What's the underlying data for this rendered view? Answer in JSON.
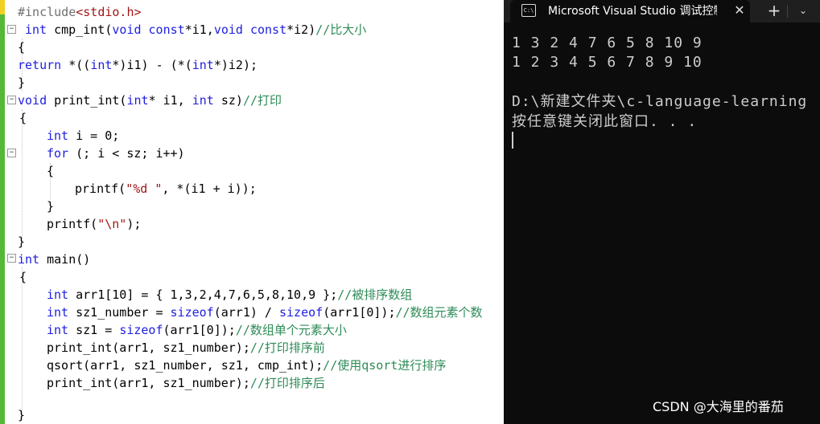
{
  "editor": {
    "lines": [
      {
        "segments": [
          {
            "c": "pp",
            "t": "#include"
          },
          {
            "c": "st",
            "t": "<stdio.h>"
          }
        ]
      },
      {
        "segments": [
          {
            "c": "kw",
            "t": "int"
          },
          {
            "c": "",
            "t": " cmp_int("
          },
          {
            "c": "kw",
            "t": "void const"
          },
          {
            "c": "",
            "t": "*i1,"
          },
          {
            "c": "kw",
            "t": "void const"
          },
          {
            "c": "",
            "t": "*i2)"
          },
          {
            "c": "cm",
            "t": "//比大小"
          }
        ]
      },
      {
        "segments": [
          {
            "c": "",
            "t": "{"
          }
        ]
      },
      {
        "segments": [
          {
            "c": "kw",
            "t": "return"
          },
          {
            "c": "",
            "t": " *(("
          },
          {
            "c": "kw",
            "t": "int"
          },
          {
            "c": "",
            "t": "*)i1) - (*("
          },
          {
            "c": "kw",
            "t": "int"
          },
          {
            "c": "",
            "t": "*)i2);"
          }
        ]
      },
      {
        "segments": [
          {
            "c": "",
            "t": "}"
          }
        ]
      },
      {
        "segments": [
          {
            "c": "kw",
            "t": "void"
          },
          {
            "c": "",
            "t": " print_int("
          },
          {
            "c": "kw",
            "t": "int"
          },
          {
            "c": "",
            "t": "* i1, "
          },
          {
            "c": "kw",
            "t": "int"
          },
          {
            "c": "",
            "t": " sz)"
          },
          {
            "c": "cm",
            "t": "//打印"
          }
        ]
      },
      {
        "segments": [
          {
            "c": "",
            "t": "{"
          }
        ]
      },
      {
        "segments": [
          {
            "c": "kw",
            "t": "int"
          },
          {
            "c": "",
            "t": " i = 0;"
          }
        ]
      },
      {
        "segments": [
          {
            "c": "kw",
            "t": "for"
          },
          {
            "c": "",
            "t": " (; i < sz; i++)"
          }
        ]
      },
      {
        "segments": [
          {
            "c": "",
            "t": "{"
          }
        ]
      },
      {
        "segments": [
          {
            "c": "",
            "t": "printf("
          },
          {
            "c": "st",
            "t": "\"%d \""
          },
          {
            "c": "",
            "t": ", *(i1 + i));"
          }
        ]
      },
      {
        "segments": [
          {
            "c": "",
            "t": "}"
          }
        ]
      },
      {
        "segments": [
          {
            "c": "",
            "t": "printf("
          },
          {
            "c": "st",
            "t": "\"\\n\""
          },
          {
            "c": "",
            "t": ");"
          }
        ]
      },
      {
        "segments": [
          {
            "c": "",
            "t": "}"
          }
        ]
      },
      {
        "segments": [
          {
            "c": "kw",
            "t": "int"
          },
          {
            "c": "",
            "t": " main()"
          }
        ]
      },
      {
        "segments": [
          {
            "c": "",
            "t": "{"
          }
        ]
      },
      {
        "segments": []
      },
      {
        "segments": [
          {
            "c": "kw",
            "t": "int"
          },
          {
            "c": "",
            "t": " arr1[10] = { 1,3,2,4,7,6,5,8,10,9 };"
          },
          {
            "c": "cm",
            "t": "//被排序数组"
          }
        ]
      },
      {
        "segments": [
          {
            "c": "kw",
            "t": "int"
          },
          {
            "c": "",
            "t": " sz1_number = "
          },
          {
            "c": "kw",
            "t": "sizeof"
          },
          {
            "c": "",
            "t": "(arr1) / "
          },
          {
            "c": "kw",
            "t": "sizeof"
          },
          {
            "c": "",
            "t": "(arr1[0]);"
          },
          {
            "c": "cm",
            "t": "//数组元素个数"
          }
        ]
      },
      {
        "segments": [
          {
            "c": "kw",
            "t": "int"
          },
          {
            "c": "",
            "t": " sz1 = "
          },
          {
            "c": "kw",
            "t": "sizeof"
          },
          {
            "c": "",
            "t": "(arr1[0]);"
          },
          {
            "c": "cm",
            "t": "//数组单个元素大小"
          }
        ]
      },
      {
        "segments": [
          {
            "c": "",
            "t": "print_int(arr1, sz1_number);"
          },
          {
            "c": "cm",
            "t": "//打印排序前"
          }
        ]
      },
      {
        "segments": [
          {
            "c": "",
            "t": "qsort(arr1, sz1_number, sz1, cmp_int);"
          },
          {
            "c": "cm",
            "t": "//使用qsort进行排序"
          }
        ]
      },
      {
        "segments": [
          {
            "c": "",
            "t": "print_int(arr1, sz1_number);"
          },
          {
            "c": "cm",
            "t": "//打印排序后"
          }
        ]
      },
      {
        "segments": []
      },
      {
        "segments": []
      },
      {
        "segments": [
          {
            "c": "",
            "t": "}"
          }
        ]
      }
    ],
    "fold_markers": [
      "−",
      "−",
      "−",
      "−",
      "−",
      "−"
    ]
  },
  "console": {
    "tab_icon": "C:\\",
    "tab_title": "Microsoft Visual Studio 调试控制台",
    "close_glyph": "✕",
    "new_tab_glyph": "+",
    "dropdown_glyph": "⌄",
    "output_lines": [
      "1 3 2 4 7 6 5 8 10 9",
      "1 2 3 4 5 6 7 8 9 10",
      "",
      "D:\\新建文件夹\\c-language-learning",
      "按任意键关闭此窗口. . ."
    ]
  },
  "watermark": "CSDN @大海里的番茄",
  "colors": {
    "keyword": "#1e1ee0",
    "comment": "#2e8b57",
    "string": "#a31515",
    "console_bg": "#0c0c0c",
    "console_text": "#cccccc",
    "change_bar": "#57b837"
  }
}
